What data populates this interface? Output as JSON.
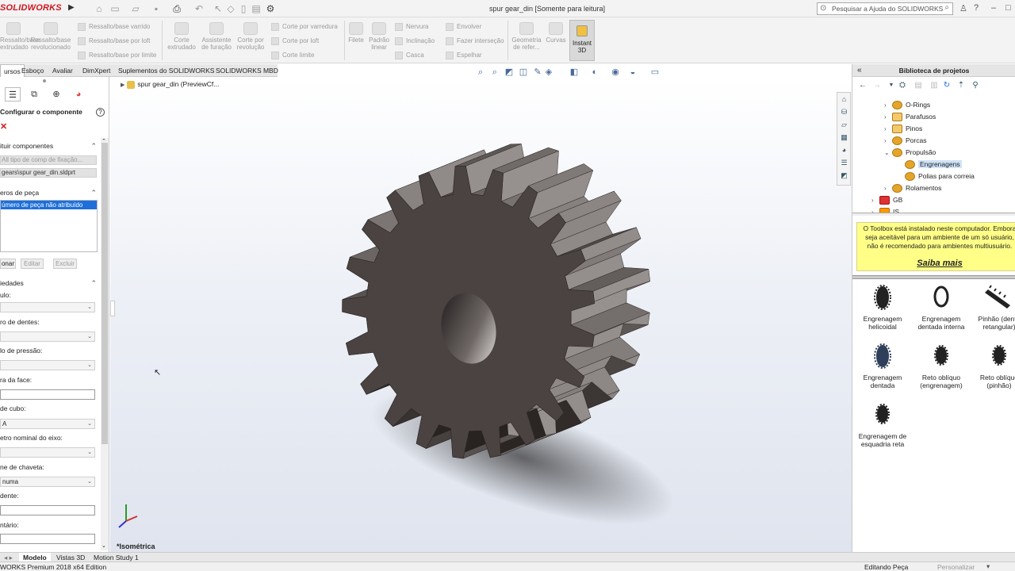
{
  "app": {
    "logo": "SOLIDWORKS",
    "document_title": "spur gear_din [Somente para leitura]",
    "help_search_placeholder": "Pesquisar a Ajuda do SOLIDWORKS"
  },
  "command_manager": {
    "boss_extrude": "Ressalto/base\nextrudado",
    "boss_revolve": "Ressalto/base\nrevolucionado",
    "swept_boss": "Ressalto/base varrido",
    "lofted_boss": "Ressalto/base por loft",
    "boundary_boss": "Ressalto/base por limite",
    "extruded_cut": "Corte\nextrudado",
    "hole_wizard": "Assistente\nde furação",
    "revolved_cut": "Corte por\nrevolução",
    "swept_cut": "Corte por varredura",
    "lofted_cut": "Corte por loft",
    "boundary_cut": "Corte limite",
    "fillet": "Filete",
    "linear_pattern": "Padrão\nlinear",
    "rib": "Nervura",
    "draft": "Inclinação",
    "shell": "Casca",
    "wrap": "Envolver",
    "intersect": "Fazer interseção",
    "mirror": "Espelhar",
    "reference_geometry": "Geometria\nde refer...",
    "curves": "Curvas",
    "instant3d": "Instant\n3D"
  },
  "tabs": [
    "ursos",
    "Esboço",
    "Avaliar",
    "DimXpert",
    "Suplementos do SOLIDWORKS",
    "SOLIDWORKS MBD"
  ],
  "left_panel": {
    "title": "Configurar o componente",
    "section_components": "ituir componentes",
    "fastener_type_placeholder": "All tipo de comp de fixação...",
    "component_path": "gears\\spur gear_din.sldprt",
    "section_part_numbers": "eros de peça",
    "part_number_selected": "úmero de peça não atribuído",
    "btn_add": "onar",
    "btn_edit": "Editar",
    "btn_delete": "Excluir",
    "section_properties": "iedades",
    "prop_module": "ulo:",
    "prop_teeth": "ro de dentes:",
    "prop_pressure": "lo de pressão:",
    "prop_face_width": "ra da face:",
    "prop_hub_style": "de cubo:",
    "prop_hub_value": "A",
    "prop_shaft_dia": "etro nominal do eixo:",
    "prop_keyway": "ne de chaveta:",
    "prop_keyway_value": "numa",
    "prop_tooth_name": " dente:",
    "prop_comment": "ntário:"
  },
  "viewport": {
    "feature_tree_root": "spur gear_din  (PreviewCf...",
    "view_orientation": "*Isométrica"
  },
  "bottom_tabs": [
    "Modelo",
    "Vistas 3D",
    "Motion Study 1"
  ],
  "status": {
    "edition": "WORKS Premium 2018 x64 Edition",
    "mode": "Editando Peça",
    "customize": "Personalizar"
  },
  "right_panel": {
    "title": "Biblioteca de projetos",
    "tree": [
      {
        "label": "O-Rings",
        "expanded": false
      },
      {
        "label": "Parafusos",
        "expanded": false
      },
      {
        "label": "Pinos",
        "expanded": false
      },
      {
        "label": "Porcas",
        "expanded": false
      },
      {
        "label": "Propulsão",
        "expanded": true
      },
      {
        "label": "Engrenagens",
        "selected": true
      },
      {
        "label": "Polias para correia"
      },
      {
        "label": "Rolamentos",
        "expanded": false
      },
      {
        "label": "GB",
        "expanded": false
      },
      {
        "label": "IS",
        "expanded": false
      }
    ],
    "banner_text": "O Toolbox está instalado neste computador. Embora seja aceitável para um ambiente de um só usuário, não é recomendado para ambientes multiusuário.",
    "banner_link": "Saiba mais",
    "items": [
      "Engrenagem\nhelicoidal",
      "Engrenagem\ndentada interna",
      "Pinhão (denta\nretangular)",
      "Engrenagem\ndentada",
      "Reto oblíquo\n(engrenagem)",
      "Reto oblíquo\n(pinhão)",
      "Engrenagem de\nesquadria reta"
    ]
  },
  "colors": {
    "brand_red": "#d0161e",
    "selection_blue": "#1e6fd9",
    "banner_yellow": "#ffff88",
    "gear_body": "#4a4341"
  }
}
